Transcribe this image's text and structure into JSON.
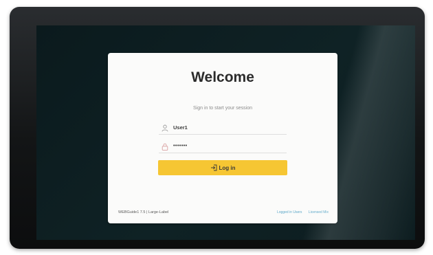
{
  "login": {
    "title": "Welcome",
    "subtitle": "Sign in to start your session",
    "username_value": "User1",
    "password_value": "•••••••",
    "login_label": "Log in"
  },
  "footer": {
    "version": "WEBGuide1 7.5  |  Large-Label",
    "links": [
      "Logged in Users",
      "Licensed Mix"
    ]
  },
  "colors": {
    "accent": "#f6c633",
    "link": "#5da8c8",
    "screen_bg": "#0f2225"
  },
  "icons": {
    "username": "user-icon",
    "password": "lock-icon",
    "login": "login-arrow-icon"
  }
}
